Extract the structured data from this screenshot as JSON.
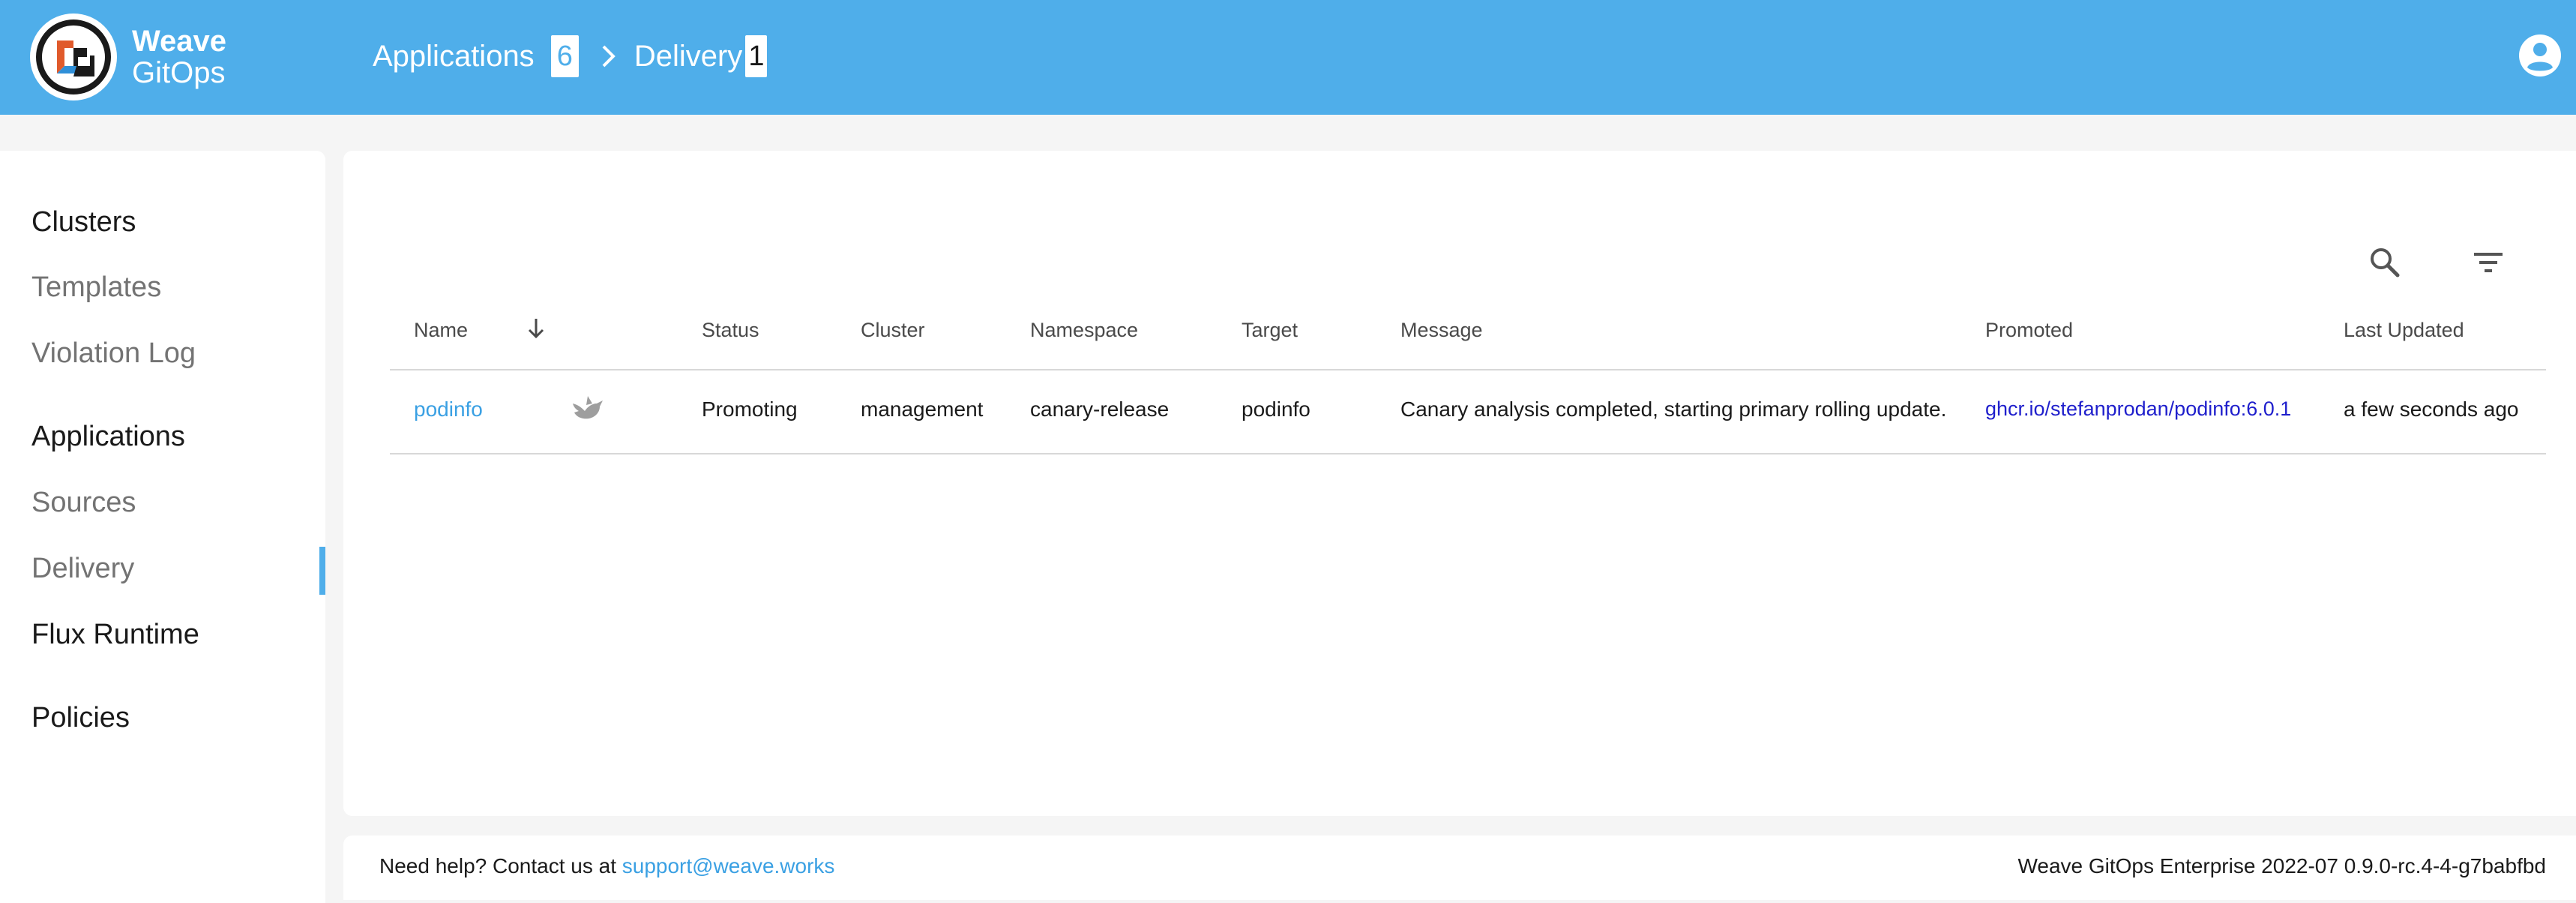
{
  "brand": {
    "line1": "Weave",
    "line2": "GitOps",
    "colors": {
      "header": "#4faeea",
      "link": "#3aa0e3",
      "promoted": "#1f1fcc"
    }
  },
  "breadcrumb": {
    "items": [
      {
        "label": "Applications",
        "count": "6"
      },
      {
        "label": "Delivery",
        "count": "1"
      }
    ],
    "separator_icon": "chevron-right-icon"
  },
  "header": {
    "user_icon": "account-circle-icon"
  },
  "sidebar": {
    "items": [
      {
        "label": "Clusters",
        "group": true
      },
      {
        "label": "Templates",
        "group": false
      },
      {
        "label": "Violation Log",
        "group": false
      },
      {
        "label": "Applications",
        "group": true
      },
      {
        "label": "Sources",
        "group": false
      },
      {
        "label": "Delivery",
        "group": false,
        "active": true
      },
      {
        "label": "Flux Runtime",
        "group": true
      },
      {
        "label": "Policies",
        "group": true
      }
    ]
  },
  "toolbar": {
    "search_icon": "search-icon",
    "filter_icon": "filter-icon"
  },
  "table": {
    "headers": {
      "name": "Name",
      "sort_icon": "arrow-down-icon",
      "status": "Status",
      "cluster": "Cluster",
      "namespace": "Namespace",
      "target": "Target",
      "message": "Message",
      "promoted": "Promoted",
      "last_updated": "Last Updated"
    },
    "rows": [
      {
        "name": "podinfo",
        "provider_icon": "canary-bird-icon",
        "status": "Promoting",
        "cluster": "management",
        "namespace": "canary-release",
        "target": "podinfo",
        "message": "Canary analysis completed, starting primary rolling update.",
        "promoted": "ghcr.io/stefanprodan/podinfo:6.0.1",
        "last_updated": "a few seconds ago"
      }
    ]
  },
  "footer": {
    "help_text": "Need help? Contact us at",
    "email": "support@weave.works",
    "version": "Weave GitOps Enterprise 2022-07 0.9.0-rc.4-4-g7babfbd"
  }
}
